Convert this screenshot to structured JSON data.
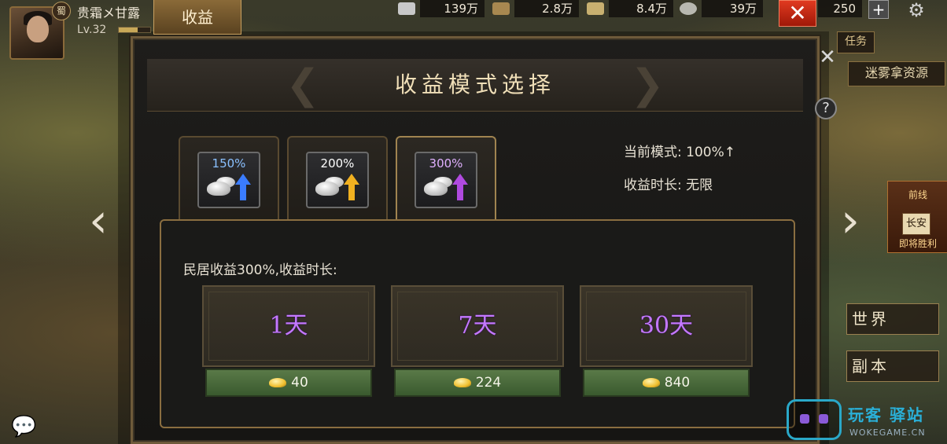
{
  "player": {
    "kingdom": "蜀",
    "name": "贵霜メ甘露",
    "level": "Lv.32",
    "exp_fraction": 0.6
  },
  "top_tab": "收益",
  "resources": [
    {
      "icon": "silver-ingot-icon",
      "value": "139万"
    },
    {
      "icon": "wood-icon",
      "value": "2.8万"
    },
    {
      "icon": "grain-icon",
      "value": "8.4万"
    },
    {
      "icon": "stone-icon",
      "value": "39万"
    },
    {
      "icon": "gold-icon",
      "value": "250"
    }
  ],
  "side": {
    "task": "任务",
    "fog": "迷雾拿资源",
    "city": {
      "title": "前线",
      "name": "长安",
      "status": "即将胜利"
    },
    "world": "世界",
    "dungeon": "副本"
  },
  "dialog": {
    "title": "收益模式选择",
    "modes": [
      {
        "pct": "150%",
        "arrow_color": "#3a7cff"
      },
      {
        "pct": "200%",
        "arrow_color": "#f0b020"
      },
      {
        "pct": "300%",
        "arrow_color": "#b04ae0"
      }
    ],
    "current_mode_label": "当前模式: 100%↑",
    "duration_label": "收益时长: 无限",
    "panel_label": "民居收益300%,收益时长:",
    "durations": [
      {
        "label": "1天",
        "cost": "40"
      },
      {
        "label": "7天",
        "cost": "224"
      },
      {
        "label": "30天",
        "cost": "840"
      }
    ]
  },
  "watermark": {
    "text": "玩客 驿站",
    "sub": "WOKEGAME.CN"
  }
}
